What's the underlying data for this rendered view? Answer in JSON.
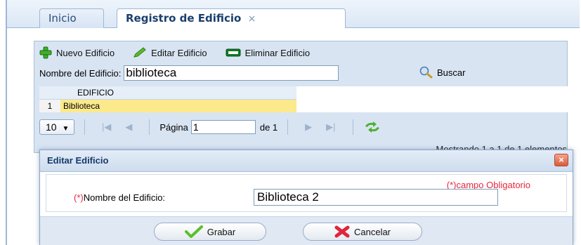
{
  "tabs": [
    {
      "label": "Inicio"
    },
    {
      "label": "Registro de Edificio",
      "close": "×"
    }
  ],
  "toolbar": {
    "new_label": "Nuevo Edificio",
    "edit_label": "Editar Edificio",
    "delete_label": "Eliminar Edificio"
  },
  "search": {
    "label": "Nombre del Edificio:",
    "value": "biblioteca",
    "button_label": "Buscar"
  },
  "grid": {
    "column_header": "EDIFICIO",
    "rows": [
      {
        "num": "1",
        "edificio": "Biblioteca"
      }
    ]
  },
  "pager": {
    "page_size": "10",
    "page_label": "Página",
    "page_value": "1",
    "of_label": "de 1",
    "status": "Mostrando 1 a 1 de 1 elementos"
  },
  "dialog": {
    "title": "Editar Edificio",
    "close": "×",
    "required_note": "(*)campo Obligatorio",
    "field_asterisk": "(*)",
    "field_label": "Nombre del Edificio:",
    "field_value": "Biblioteca 2",
    "save_label": "Grabar",
    "cancel_label": "Cancelar"
  },
  "colors": {
    "selected_row": "#fbe98b",
    "required": "#e8263d",
    "panel": "#d8e4f2"
  }
}
